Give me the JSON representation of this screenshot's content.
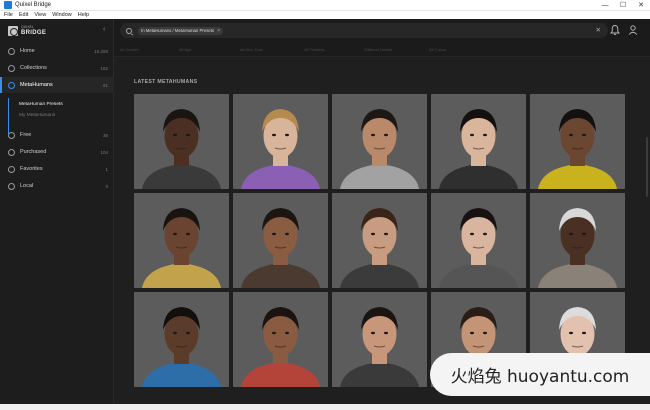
{
  "window": {
    "title": "Quixel Bridge",
    "controls": [
      "—",
      "☐",
      "✕"
    ]
  },
  "menu": [
    "File",
    "Edit",
    "View",
    "Window",
    "Help"
  ],
  "logo": {
    "small": "QUIXEL",
    "big": "BRIDGE"
  },
  "collapse_icon": "‹",
  "sidebar": {
    "items": [
      {
        "label": "Home",
        "count": "15,268",
        "icon": "home-icon"
      },
      {
        "label": "Collections",
        "count": "162",
        "icon": "collections-icon"
      },
      {
        "label": "MetaHumans",
        "count": "61",
        "icon": "metahuman-icon",
        "active": true
      },
      {
        "label": "Free",
        "count": "36",
        "icon": "free-icon"
      },
      {
        "label": "Purchased",
        "count": "104",
        "icon": "purchased-icon"
      },
      {
        "label": "Favorites",
        "count": "1",
        "icon": "heart-icon"
      },
      {
        "label": "Local",
        "count": "0",
        "icon": "local-icon"
      }
    ],
    "sub": [
      "MetaHuman Presets",
      "My MetaHumans"
    ]
  },
  "search": {
    "chip": "In MetaHumans / MetaHuman Presets",
    "clear": "✕"
  },
  "filters": [
    "All Gender",
    "All Age",
    "All Skin Tone",
    "All Freckles",
    "Different Details",
    "All Colors"
  ],
  "section": {
    "title": "LATEST METAHUMANS"
  },
  "colors": {
    "accent": "#3d8ee8",
    "card_bg": "#5b5b5b"
  },
  "watermark": "火焰兔 huoyantu.com"
}
